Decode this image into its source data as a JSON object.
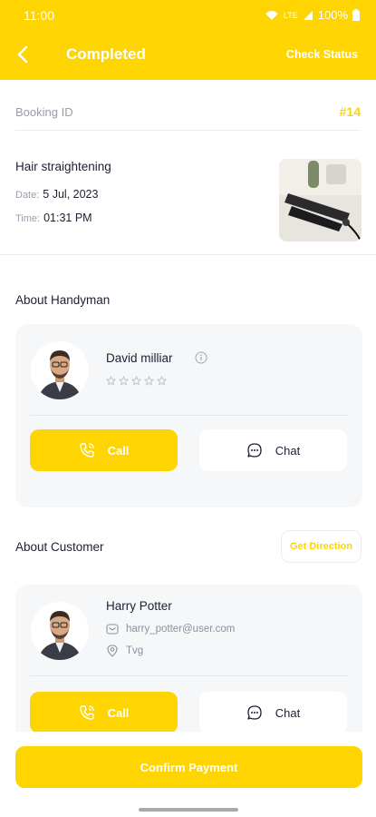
{
  "status_bar": {
    "time": "11:00",
    "network": "LTE",
    "battery": "100%"
  },
  "app_bar": {
    "title": "Completed",
    "action": "Check Status"
  },
  "booking": {
    "id_label": "Booking ID",
    "id_value": "#14",
    "service_name": "Hair straightening",
    "date_label": "Date:",
    "date_value": "5 Jul, 2023",
    "time_label": "Time:",
    "time_value": "01:31 PM"
  },
  "handyman": {
    "section_title": "About Handyman",
    "name": "David milliar",
    "rating": 0,
    "rating_max": 5,
    "call_label": "Call",
    "chat_label": "Chat"
  },
  "customer": {
    "section_title": "About Customer",
    "direction_label": "Get Direction",
    "name": "Harry Potter",
    "email": "harry_potter@user.com",
    "address": "Tvg",
    "call_label": "Call",
    "chat_label": "Chat"
  },
  "footer": {
    "confirm_label": "Confirm Payment"
  },
  "colors": {
    "accent": "#fed501",
    "text": "#1c1f34",
    "muted": "#9a9cab",
    "card_bg": "#f6f7f9"
  },
  "icons": [
    "back-arrow-icon",
    "wifi-icon",
    "signal-icon",
    "battery-icon",
    "info-icon",
    "star-outline-icon",
    "phone-icon",
    "chat-bubble-icon",
    "mail-icon",
    "location-pin-icon"
  ]
}
